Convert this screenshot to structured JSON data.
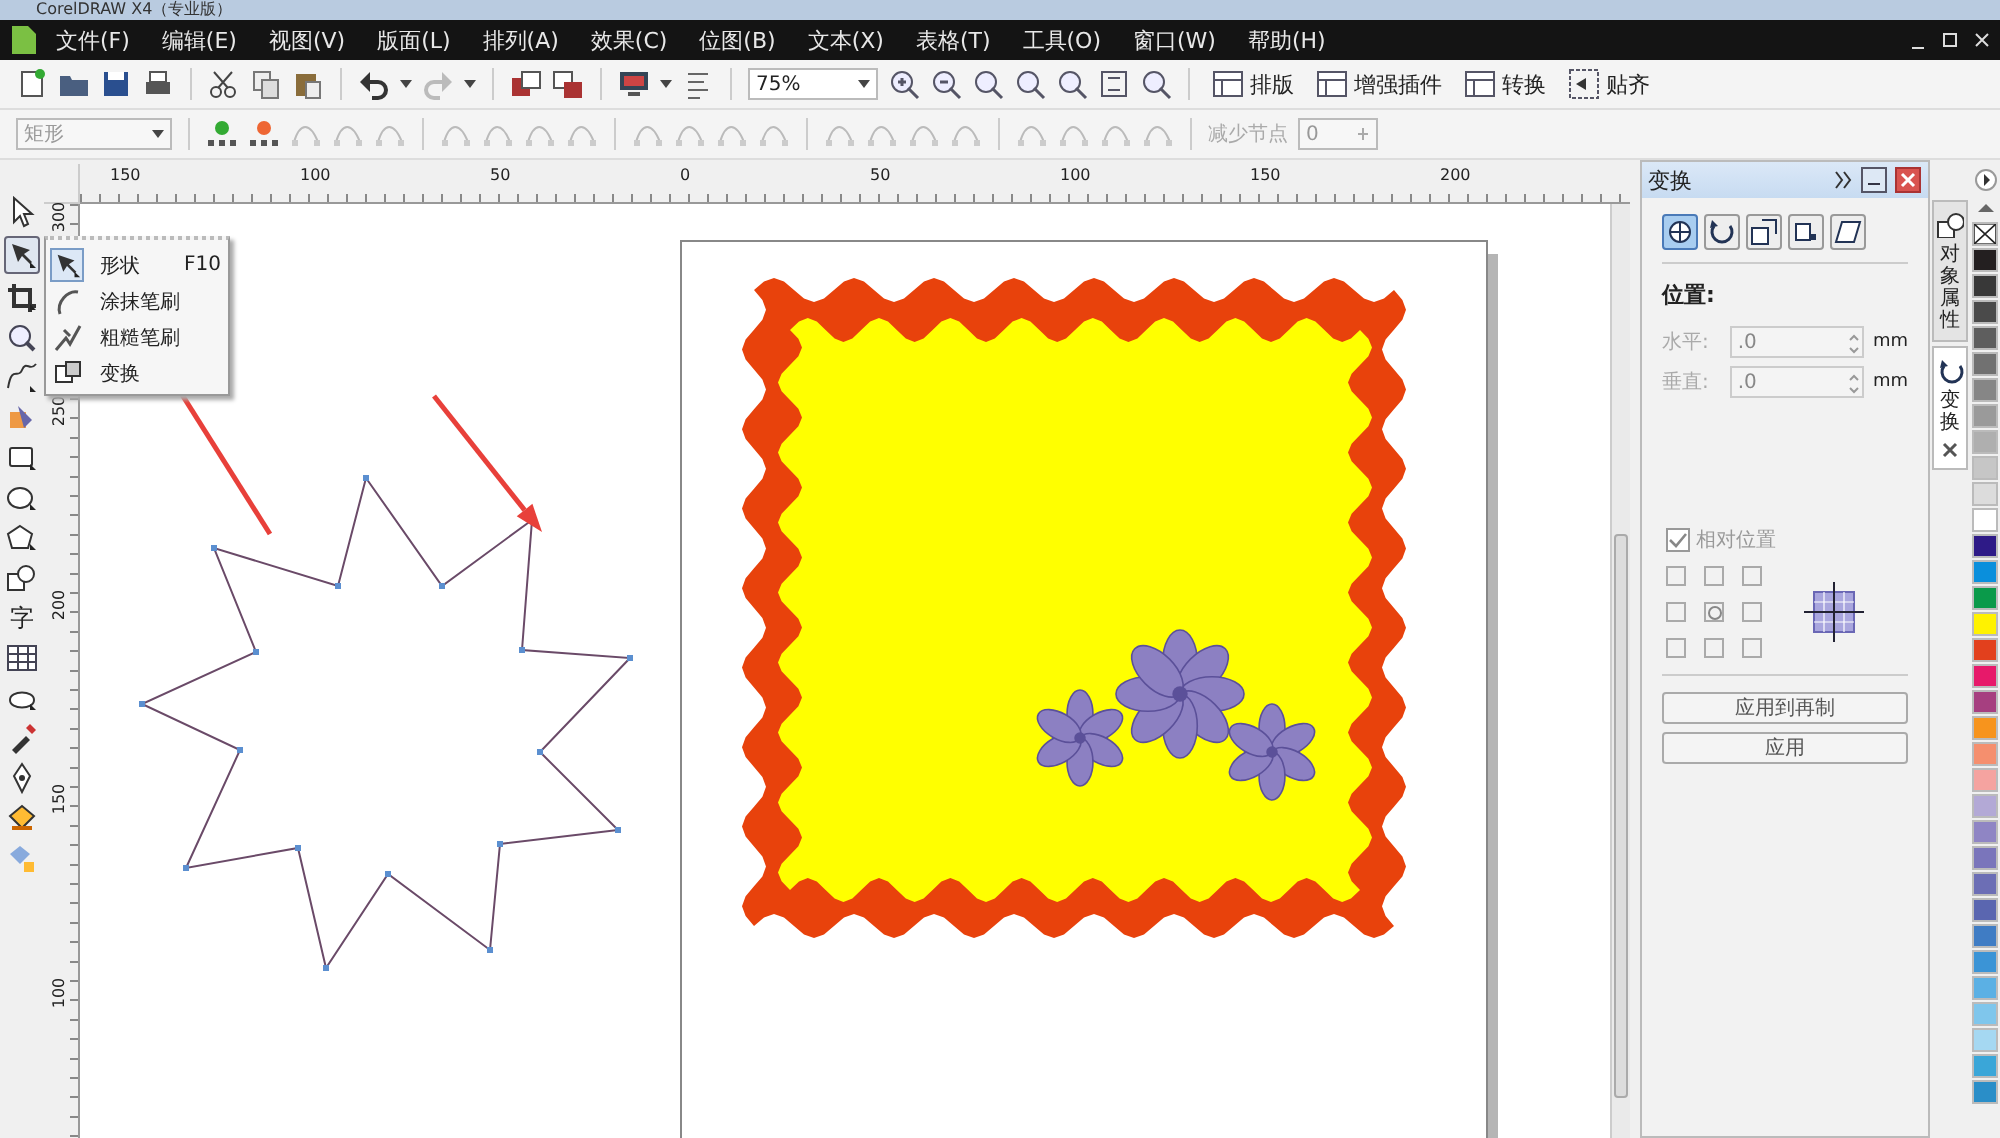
{
  "window": {
    "title": "CorelDRAW X4（专业版）"
  },
  "menu": [
    "文件(F)",
    "编辑(E)",
    "视图(V)",
    "版面(L)",
    "排列(A)",
    "效果(C)",
    "位图(B)",
    "文本(X)",
    "表格(T)",
    "工具(O)",
    "窗口(W)",
    "帮助(H)"
  ],
  "standard_toolbar": {
    "zoom": "75%",
    "buttons": [
      "排版",
      "增强插件",
      "转换",
      "贴齐"
    ]
  },
  "property_bar": {
    "object_type": "矩形",
    "reduce_nodes_label": "减少节点",
    "reduce_nodes_value": "0"
  },
  "rulers": {
    "horizontal": [
      "150",
      "100",
      "50",
      "0",
      "50",
      "100",
      "150",
      "200"
    ],
    "vertical": [
      "300",
      "250",
      "200",
      "150",
      "100"
    ]
  },
  "toolbox": [
    {
      "selected": false
    },
    {
      "selected": true
    },
    {
      "selected": false
    },
    {
      "selected": false
    },
    {
      "selected": false
    },
    {
      "selected": false
    },
    {
      "selected": false
    },
    {
      "selected": false
    },
    {
      "selected": false
    },
    {
      "selected": false
    },
    {
      "label": "字",
      "selected": false
    },
    {
      "selected": false
    },
    {
      "selected": false
    },
    {
      "selected": false
    },
    {
      "selected": false
    },
    {
      "selected": false
    },
    {
      "selected": false
    }
  ],
  "flyout": [
    {
      "label": "形状",
      "shortcut": "F10",
      "selected": true
    },
    {
      "label": "涂抹笔刷",
      "selected": false
    },
    {
      "label": "粗糙笔刷",
      "selected": false
    },
    {
      "label": "变换",
      "selected": false
    }
  ],
  "docker": {
    "title": "变换",
    "modes": [
      {
        "selected": true
      },
      {
        "selected": false
      },
      {
        "selected": false
      },
      {
        "selected": false
      },
      {
        "selected": false
      }
    ],
    "section": "位置:",
    "fields": [
      {
        "label": "水平:",
        "value": ".0",
        "unit": "mm",
        "disabled": true
      },
      {
        "label": "垂直:",
        "value": ".0",
        "unit": "mm",
        "disabled": true
      }
    ],
    "relative_position": {
      "label": "相对位置",
      "checked": true,
      "disabled": true
    },
    "anchors": [
      {
        "selected": false
      },
      {
        "selected": false
      },
      {
        "selected": false
      },
      {
        "selected": false
      },
      {
        "selected": true
      },
      {
        "selected": false
      },
      {
        "selected": false
      },
      {
        "selected": false
      },
      {
        "selected": false
      }
    ],
    "buttons": [
      "应用到再制",
      "应用"
    ]
  },
  "docker_tabs": [
    {
      "label": "对象属性",
      "selected": false
    },
    {
      "label": "变换",
      "selected": true
    }
  ],
  "palette": [
    {
      "kind": "none"
    },
    {
      "color": "#231f20"
    },
    {
      "color": "#383838"
    },
    {
      "color": "#4a4a4a"
    },
    {
      "color": "#5e5e5e"
    },
    {
      "color": "#717171"
    },
    {
      "color": "#868686"
    },
    {
      "color": "#9a9a9a"
    },
    {
      "color": "#afafaf"
    },
    {
      "color": "#c6c6c6"
    },
    {
      "color": "#dcdcdc"
    },
    {
      "color": "#ffffff"
    },
    {
      "color": "#2e1a87"
    },
    {
      "color": "#0a8fdc"
    },
    {
      "color": "#0a9a4a"
    },
    {
      "color": "#fff200"
    },
    {
      "color": "#e2401d"
    },
    {
      "color": "#e7196a"
    },
    {
      "color": "#a63f80"
    },
    {
      "color": "#f7941d"
    },
    {
      "color": "#f58f6e"
    },
    {
      "color": "#f5a3a0"
    },
    {
      "color": "#b3a9d6"
    },
    {
      "color": "#8f85c4"
    },
    {
      "color": "#7a75bb"
    },
    {
      "color": "#6c6eb5"
    },
    {
      "color": "#5a66b0"
    },
    {
      "color": "#3f7cc4"
    },
    {
      "color": "#3b94d6"
    },
    {
      "color": "#5bb0e4"
    },
    {
      "color": "#7fc6ec"
    },
    {
      "color": "#a5d8f2"
    },
    {
      "color": "#3aa6d8"
    },
    {
      "color": "#2a8ec8"
    }
  ]
}
